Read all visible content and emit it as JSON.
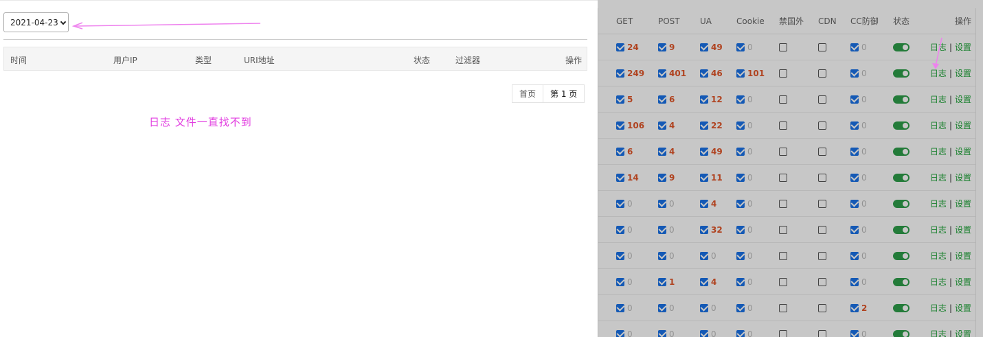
{
  "dialog": {
    "date_value": "2021-04-23",
    "columns": [
      "时间",
      "用户IP",
      "类型",
      "URI地址",
      "状态",
      "过滤器",
      "操作"
    ],
    "pager": {
      "first": "首页",
      "current": "第 1 页"
    },
    "annotation_text": "日志 文件一直找不到"
  },
  "background_table": {
    "headers": [
      "GET",
      "POST",
      "UA",
      "Cookie",
      "禁国外",
      "CDN",
      "CC防御",
      "状态",
      "操作"
    ],
    "op_log": "日志",
    "op_sep": "|",
    "op_settings": "设置",
    "rows": [
      {
        "get": "24",
        "post": "9",
        "ua": "49",
        "cookie": "0",
        "cc": "0"
      },
      {
        "get": "249",
        "post": "401",
        "ua": "46",
        "cookie": "101",
        "cc": "0"
      },
      {
        "get": "5",
        "post": "6",
        "ua": "12",
        "cookie": "0",
        "cc": "0"
      },
      {
        "get": "106",
        "post": "4",
        "ua": "22",
        "cookie": "0",
        "cc": "0"
      },
      {
        "get": "6",
        "post": "4",
        "ua": "49",
        "cookie": "0",
        "cc": "0"
      },
      {
        "get": "14",
        "post": "9",
        "ua": "11",
        "cookie": "0",
        "cc": "0"
      },
      {
        "get": "0",
        "post": "0",
        "ua": "4",
        "cookie": "0",
        "cc": "0"
      },
      {
        "get": "0",
        "post": "0",
        "ua": "32",
        "cookie": "0",
        "cc": "0"
      },
      {
        "get": "0",
        "post": "0",
        "ua": "0",
        "cookie": "0",
        "cc": "0"
      },
      {
        "get": "0",
        "post": "1",
        "ua": "4",
        "cookie": "0",
        "cc": "0"
      },
      {
        "get": "0",
        "post": "0",
        "ua": "0",
        "cookie": "0",
        "cc": "2"
      },
      {
        "get": "0",
        "post": "0",
        "ua": "0",
        "cookie": "0",
        "cc": "0"
      }
    ]
  },
  "colors": {
    "accent_number": "#e2572a",
    "zero_number": "#bbbbbb",
    "link_green": "#20a53a",
    "checkbox_blue": "#1a73e8",
    "annotation_magenta": "#e23ee0"
  },
  "icons": [
    "checkbox-checked-icon",
    "checkbox-empty-icon",
    "toggle-on-icon",
    "dropdown-caret-icon",
    "arrow-annotation-icon"
  ]
}
